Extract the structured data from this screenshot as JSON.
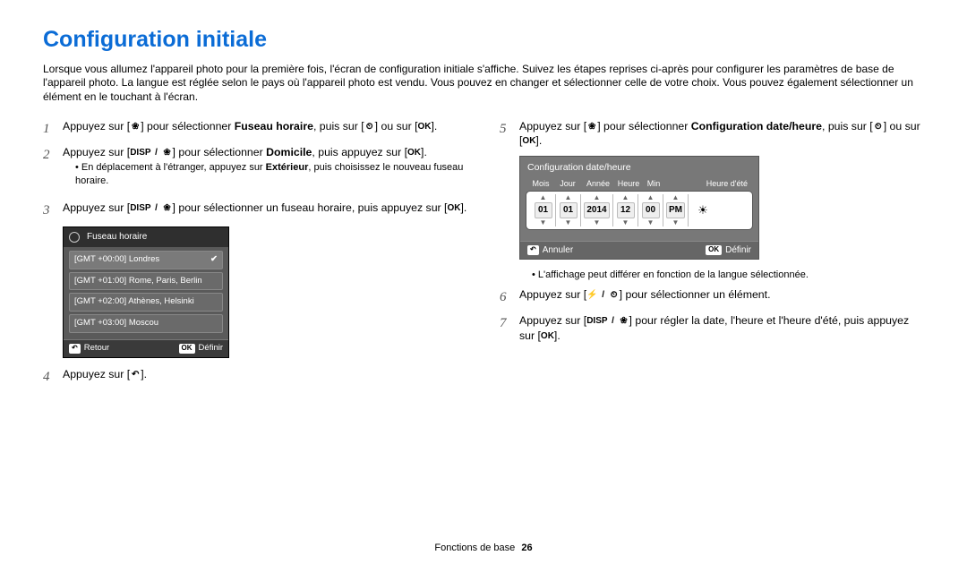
{
  "title": "Configuration initiale",
  "intro": "Lorsque vous allumez l'appareil photo pour la première fois, l'écran de configuration initiale s'affiche. Suivez les étapes reprises ci-après pour configurer les paramètres de base de l'appareil photo. La langue est réglée selon le pays où l'appareil photo est vendu. Vous pouvez en changer et sélectionner celle de votre choix. Vous pouvez également sélectionner un élément en le touchant à l'écran.",
  "steps": {
    "s1_a": "Appuyez sur [",
    "s1_b": "] pour sélectionner ",
    "s1_bold": "Fuseau horaire",
    "s1_c": ", puis sur [",
    "s1_d": "] ou sur [",
    "s1_e": "].",
    "s2_a": "Appuyez sur [",
    "s2_b": "] pour sélectionner ",
    "s2_bold": "Domicile",
    "s2_c": ", puis appuyez sur [",
    "s2_d": "].",
    "s2_note_a": "En déplacement à l'étranger, appuyez sur ",
    "s2_note_bold": "Extérieur",
    "s2_note_b": ", puis choisissez le nouveau fuseau horaire.",
    "s3_a": "Appuyez sur [",
    "s3_b": "] pour sélectionner un fuseau horaire, puis appuyez sur [",
    "s3_c": "].",
    "s4_a": "Appuyez sur [",
    "s4_b": "].",
    "s5_a": "Appuyez sur [",
    "s5_b": "] pour sélectionner ",
    "s5_bold": "Configuration date/heure",
    "s5_c": ", puis sur [",
    "s5_d": "] ou sur [",
    "s5_e": "].",
    "s5_note": "L'affichage peut différer en fonction de la langue sélectionnée.",
    "s6_a": "Appuyez sur [",
    "s6_b": "] pour sélectionner un élément.",
    "s7_a": "Appuyez sur [",
    "s7_b": "] pour régler la date, l'heure et l'heure d'été, puis appuyez sur [",
    "s7_c": "]."
  },
  "icons": {
    "disp": "DISP",
    "ok": "OK",
    "flower": "❀",
    "timer": "⏲",
    "flash": "⚡",
    "slash": "/",
    "back": "↶"
  },
  "tz": {
    "header": "Fuseau horaire",
    "items": [
      {
        "label": "[GMT +00:00] Londres",
        "selected": true
      },
      {
        "label": "[GMT +01:00] Rome, Paris, Berlin",
        "selected": false
      },
      {
        "label": "[GMT +02:00] Athènes, Helsinki",
        "selected": false
      },
      {
        "label": "[GMT +03:00] Moscou",
        "selected": false
      }
    ],
    "back": "Retour",
    "set": "Définir"
  },
  "dt": {
    "title": "Configuration date/heure",
    "labels": {
      "mois": "Mois",
      "jour": "Jour",
      "annee": "Année",
      "heure": "Heure",
      "min": "Min",
      "dst": "Heure d'été"
    },
    "values": {
      "mois": "01",
      "jour": "01",
      "annee": "2014",
      "heure": "12",
      "min": "00",
      "ampm": "PM"
    },
    "cancel": "Annuler",
    "set": "Définir"
  },
  "footer": {
    "section": "Fonctions de base",
    "page": "26"
  }
}
